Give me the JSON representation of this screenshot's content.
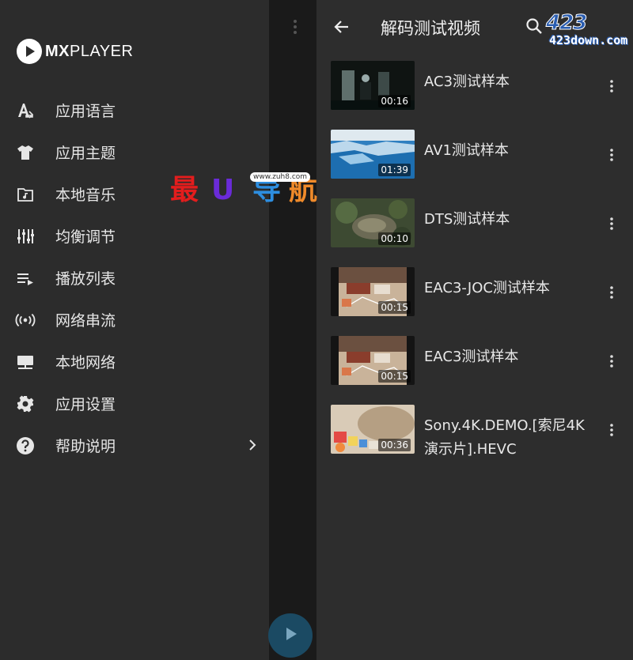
{
  "drawer": {
    "logo_text_bold": "MX",
    "logo_text_rest": "PLAYER",
    "items": [
      {
        "label": "应用语言",
        "icon": "language-icon"
      },
      {
        "label": "应用主题",
        "icon": "tshirt-icon"
      },
      {
        "label": "本地音乐",
        "icon": "music-folder-icon"
      },
      {
        "label": "均衡调节",
        "icon": "equalizer-icon"
      },
      {
        "label": "播放列表",
        "icon": "playlist-icon"
      },
      {
        "label": "网络串流",
        "icon": "stream-icon"
      },
      {
        "label": "本地网络",
        "icon": "local-network-icon"
      },
      {
        "label": "应用设置",
        "icon": "gear-icon"
      },
      {
        "label": "帮助说明",
        "icon": "help-icon",
        "has_chevron": true
      }
    ]
  },
  "appbar": {
    "title": "解码测试视频"
  },
  "videos": [
    {
      "title": "AC3测试样本",
      "duration": "00:16"
    },
    {
      "title": "AV1测试样本",
      "duration": "01:39"
    },
    {
      "title": "DTS测试样本",
      "duration": "00:10"
    },
    {
      "title": "EAC3-JOC测试样本",
      "duration": "00:15"
    },
    {
      "title": "EAC3测试样本",
      "duration": "00:15"
    },
    {
      "title": "Sony.4K.DEMO.[索尼4K演示片].HEVC",
      "duration": "00:36"
    }
  ],
  "watermarks": {
    "zuh8_chars": [
      "最",
      "U",
      "导",
      "航"
    ],
    "zuh8_url": "www.zuh8.com",
    "site_big": "423",
    "site_small": "423down.com"
  },
  "colors": {
    "drawer_bg": "#2c2c2c",
    "panel_bg": "#2d2d2d",
    "fab": "#1b4a63"
  }
}
